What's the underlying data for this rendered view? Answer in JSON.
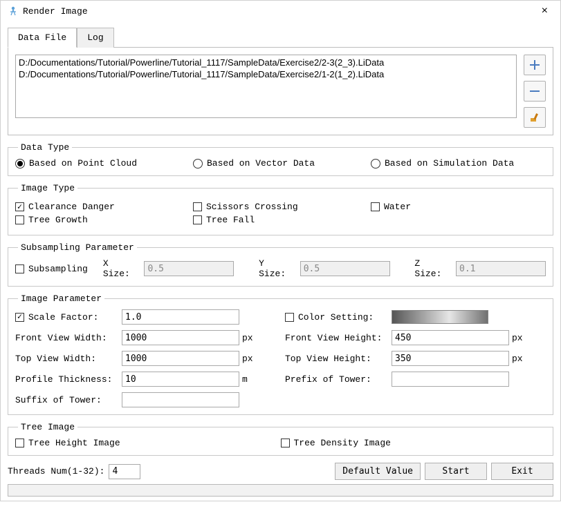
{
  "window": {
    "title": "Render Image",
    "close": "×"
  },
  "tabs": {
    "data_file": "Data File",
    "log": "Log"
  },
  "files": [
    "D:/Documentations/Tutorial/Powerline/Tutorial_1117/SampleData/Exercise2/2-3(2_3).LiData",
    "D:/Documentations/Tutorial/Powerline/Tutorial_1117/SampleData/Exercise2/1-2(1_2).LiData"
  ],
  "data_type": {
    "legend": "Data Type",
    "opt_point_cloud": "Based on Point Cloud",
    "opt_vector": "Based on Vector Data",
    "opt_simulation": "Based on Simulation Data"
  },
  "image_type": {
    "legend": "Image Type",
    "clearance": "Clearance Danger",
    "scissors": "Scissors Crossing",
    "water": "Water",
    "tree_growth": "Tree Growth",
    "tree_fall": "Tree Fall"
  },
  "subsampling": {
    "legend": "Subsampling Parameter",
    "label": "Subsampling",
    "x_label": "X Size:",
    "x_val": "0.5",
    "y_label": "Y Size:",
    "y_val": "0.5",
    "z_label": "Z Size:",
    "z_val": "0.1"
  },
  "image_param": {
    "legend": "Image Parameter",
    "scale_label": "Scale Factor:",
    "scale_val": "1.0",
    "color_label": "Color Setting:",
    "fvw_label": "Front View Width:",
    "fvw_val": "1000",
    "fvh_label": "Front View Height:",
    "fvh_val": "450",
    "tvw_label": "Top View Width:",
    "tvw_val": "1000",
    "tvh_label": "Top View Height:",
    "tvh_val": "350",
    "profile_label": "Profile Thickness:",
    "profile_val": "10",
    "prefix_label": "Prefix of Tower:",
    "prefix_val": "",
    "suffix_label": "Suffix of Tower:",
    "suffix_val": "",
    "px": "px",
    "m": "m"
  },
  "tree_image": {
    "legend": "Tree Image",
    "height": "Tree Height Image",
    "density": "Tree Density Image"
  },
  "threads": {
    "label": "Threads Num(1-32):",
    "val": "4"
  },
  "buttons": {
    "default": "Default Value",
    "start": "Start",
    "exit": "Exit"
  }
}
